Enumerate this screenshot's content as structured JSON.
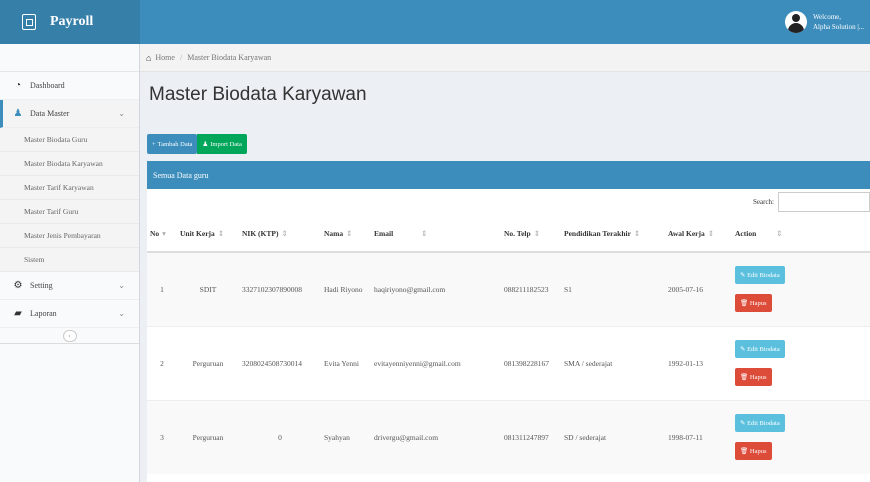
{
  "app": {
    "title": "Payroll"
  },
  "user": {
    "line1": "Welcome,",
    "line2": "Alpha Solution |..."
  },
  "sidebar": {
    "items": [
      {
        "label": "Dashboard",
        "icon": "dashboard-icon"
      },
      {
        "label": "Data Master",
        "icon": "user-icon"
      }
    ],
    "subitems": [
      "Master Biodata Guru",
      "Master Biodata Karyawan",
      "Master Tarif Karyawan",
      "Master Tarif Guru",
      "Master Jenis Pembayaran",
      "Sistem"
    ],
    "bottom": [
      {
        "label": "Setting",
        "icon": "gears-icon"
      },
      {
        "label": "Laporan",
        "icon": "book-icon"
      }
    ],
    "toggle": "‹"
  },
  "breadcrumb": {
    "home": "Home",
    "current": "Master Biodata Karyawan"
  },
  "page": {
    "title": "Master Biodata Karyawan"
  },
  "buttons": {
    "add": "Tambah Data",
    "import": "Import Data"
  },
  "panel": {
    "title": "Semua Data guru"
  },
  "search": {
    "label": "Search:",
    "value": ""
  },
  "table": {
    "headers": [
      "No",
      "Unit Kerja",
      "NIK (KTP)",
      "Nama",
      "Email",
      "No. Telp",
      "Pendidikan Terakhir",
      "Awal Kerja",
      "Action"
    ],
    "rows": [
      {
        "no": "1",
        "unit": "SDIT",
        "nik": "3327102307890008",
        "nama": "Hadi Riyono",
        "email": "haqiriyono@gmail.com",
        "telp": "088211182523",
        "pendidikan": "S1",
        "awal": "2005-07-16"
      },
      {
        "no": "2",
        "unit": "Perguruan",
        "nik": "3208024508730014",
        "nama": "Evita Yenni",
        "email": "evitayenniyenni@gmail.com",
        "telp": "081398228167",
        "pendidikan": "SMA / sederajat",
        "awal": "1992-01-13"
      },
      {
        "no": "3",
        "unit": "Perguruan",
        "nik": "0",
        "nama": "Syahyan",
        "email": "drivergu@gmail.com",
        "telp": "081311247897",
        "pendidikan": "SD / sederajat",
        "awal": "1998-07-11"
      }
    ],
    "edit_label": "Edit Biodata",
    "delete_label": "Hapus"
  }
}
